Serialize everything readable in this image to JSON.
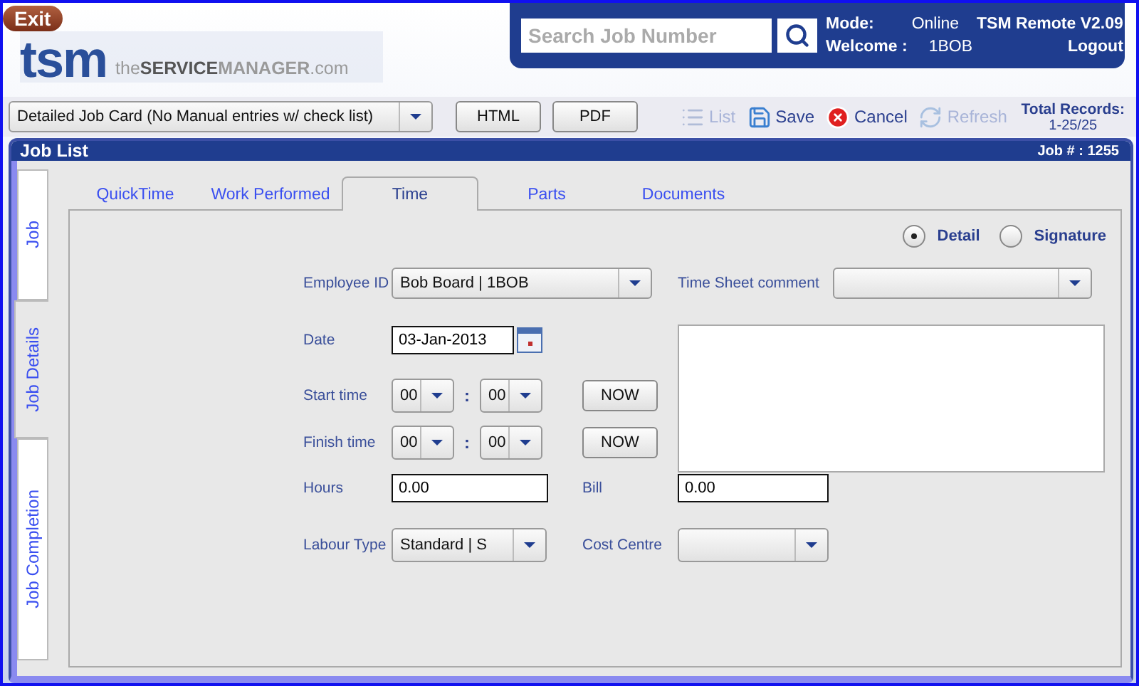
{
  "header": {
    "exit": "Exit",
    "logo_mark": "tsm",
    "logo_tagline": [
      {
        "text": "the",
        "kind": "light"
      },
      {
        "text": "SERVICE",
        "kind": "strong"
      },
      {
        "text": "MANAGER",
        "kind": "muted"
      },
      {
        "text": ".com",
        "kind": "light"
      }
    ],
    "search": {
      "placeholder": "Search Job Number"
    },
    "mode_label": "Mode:",
    "mode_value": "Online",
    "app_title": "TSM Remote V2.09",
    "welcome_label": "Welcome :",
    "welcome_value": "1BOB",
    "logout": "Logout"
  },
  "toolbar": {
    "report": "Detailed Job Card (No Manual entries w/ check list)",
    "buttons": [
      "HTML",
      "PDF"
    ],
    "actions": [
      {
        "kind": "list",
        "label": "List",
        "disabled": true
      },
      {
        "kind": "save",
        "label": "Save",
        "disabled": false
      },
      {
        "kind": "cancel",
        "label": "Cancel",
        "disabled": false
      },
      {
        "kind": "refresh",
        "label": "Refresh",
        "disabled": true
      }
    ],
    "total_label": "Total Records:",
    "total_value": "1-25/25"
  },
  "panel": {
    "title": "Job List",
    "job_label": "Job # :",
    "job_value": "1255"
  },
  "side_tabs": [
    {
      "label": "Job",
      "selected": false
    },
    {
      "label": "Job Details",
      "selected": true
    },
    {
      "label": "Job Completion",
      "selected": false
    }
  ],
  "tabs": [
    {
      "label": "QuickTime",
      "selected": false
    },
    {
      "label": "Work Performed",
      "selected": false
    },
    {
      "label": "Time",
      "selected": true
    },
    {
      "label": "Parts",
      "selected": false
    },
    {
      "label": "Documents",
      "selected": false
    }
  ],
  "view_options": [
    {
      "label": "Detail",
      "selected": true
    },
    {
      "label": "Signature",
      "selected": false
    }
  ],
  "form": {
    "employee_label": "Employee ID",
    "employee_value": "Bob Board | 1BOB",
    "comment_label": "Time Sheet comment",
    "date_label": "Date",
    "date_value": "03-Jan-2013",
    "start_label": "Start time",
    "start_hour": "00",
    "start_minute": "00",
    "finish_label": "Finish time",
    "finish_hour": "00",
    "finish_minute": "00",
    "separator": ":",
    "now_start": "NOW",
    "now_finish": "NOW",
    "hours_label": "Hours",
    "hours_value": "0.00",
    "bill_label": "Bill",
    "bill_value": "0.00",
    "labour_label": "Labour Type",
    "labour_value": "Standard | S",
    "cost_label": "Cost Centre"
  }
}
